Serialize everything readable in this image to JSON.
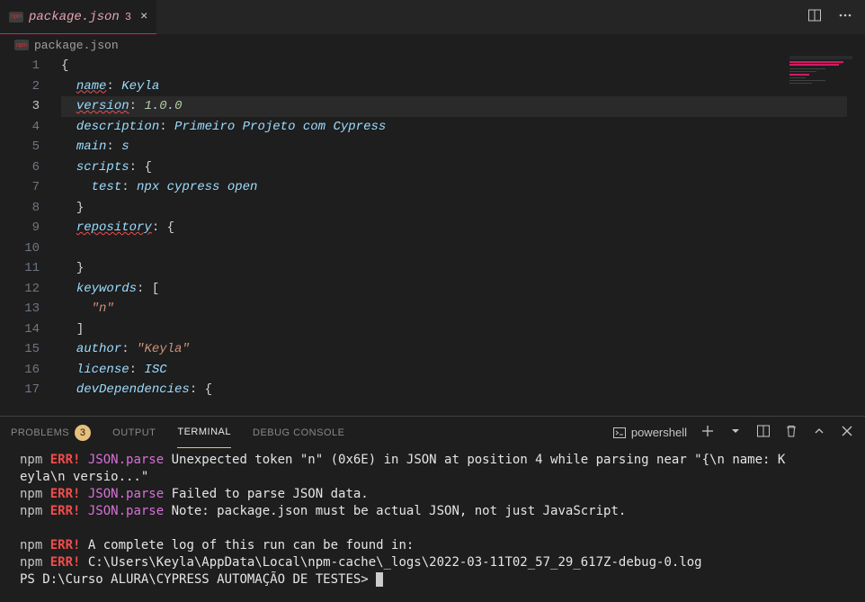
{
  "tab": {
    "filename": "package.json",
    "problem_count": "3",
    "close_label": "×"
  },
  "breadcrumb": {
    "filename": "package.json"
  },
  "gutter": [
    "1",
    "2",
    "3",
    "4",
    "5",
    "6",
    "7",
    "8",
    "9",
    "10",
    "11",
    "12",
    "13",
    "14",
    "15",
    "16",
    "17"
  ],
  "code": {
    "l1_brace": "{",
    "l2_key": "name",
    "l2_sep": ": ",
    "l2_val": "Keyla",
    "l3_key": "version",
    "l3_sep": ": ",
    "l3_v1": "1",
    "l3_d1": ".",
    "l3_v2": "0",
    "l3_d2": ".",
    "l3_v3": "0",
    "l4_key": "description",
    "l4_sep": ": ",
    "l4_val": "Primeiro Projeto com Cypress",
    "l5_key": "main",
    "l5_sep": ": ",
    "l5_val": "s",
    "l6_key": "scripts",
    "l6_sep": ": ",
    "l6_brace": "{",
    "l7_key": "test",
    "l7_sep": ": ",
    "l7_val": "npx cypress open",
    "l8_brace": "}",
    "l9_key": "repository",
    "l9_sep": ": ",
    "l9_brace": "{",
    "l10": "",
    "l11_brace": "}",
    "l12_key": "keywords",
    "l12_sep": ": ",
    "l12_bracket": "[",
    "l13_val": "\"n\"",
    "l14_bracket": "]",
    "l15_key": "author",
    "l15_sep": ": ",
    "l15_val": "\"Keyla\"",
    "l16_key": "license",
    "l16_sep": ": ",
    "l16_val": "ISC",
    "l17_key": "devDependencies",
    "l17_sep": ": ",
    "l17_brace": "{"
  },
  "panel": {
    "tabs": {
      "problems": "PROBLEMS",
      "problems_badge": "3",
      "output": "OUTPUT",
      "terminal": "TERMINAL",
      "debug": "DEBUG CONSOLE"
    },
    "shell_name": "powershell"
  },
  "terminal": {
    "l1a": "npm ",
    "l1b": "ERR! ",
    "l1c": "JSON.parse ",
    "l1d": "Unexpected token \"n\" (0x6E) in JSON at position 4 while parsing near \"{\\n  name: K",
    "l2": "eyla\\n  versio...\"",
    "l3a": "npm ",
    "l3b": "ERR! ",
    "l3c": "JSON.parse ",
    "l3d": "Failed to parse JSON data.",
    "l4a": "npm ",
    "l4b": "ERR! ",
    "l4c": "JSON.parse ",
    "l4d": "Note: package.json must be actual JSON, not just JavaScript.",
    "l5": "",
    "l6a": "npm ",
    "l6b": "ERR! ",
    "l6c": "A complete log of this run can be found in:",
    "l7a": "npm ",
    "l7b": "ERR!     ",
    "l7c": "C:\\Users\\Keyla\\AppData\\Local\\npm-cache\\_logs\\2022-03-11T02_57_29_617Z-debug-0.log",
    "l8a": "PS ",
    "l8b": "D:\\Curso ALURA\\CYPRESS AUTOMAÇÃO DE TESTES> "
  }
}
